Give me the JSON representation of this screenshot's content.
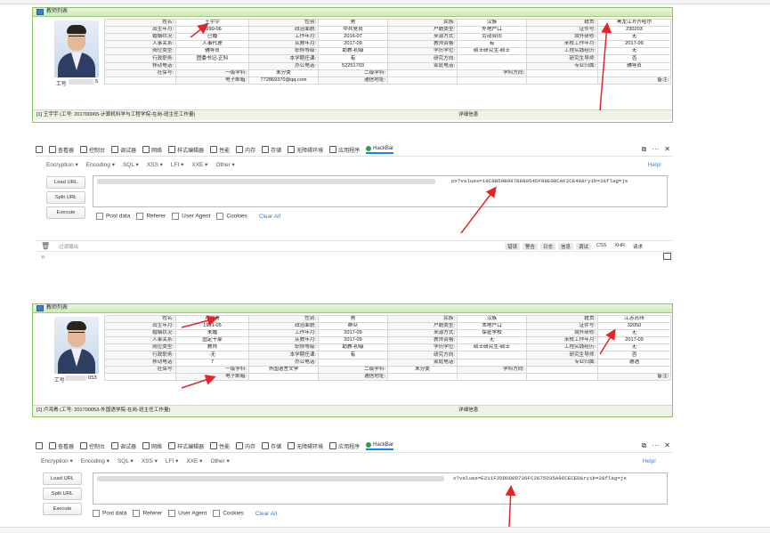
{
  "colors": {
    "accent_green": "#8cc46c",
    "annotation_red": "#e0262b",
    "hackbar_blue": "#3a7fc8"
  },
  "cards": [
    {
      "header_title": "教师列表",
      "staff_no_label": "工号",
      "staff_no_value": "5",
      "rows": [
        [
          "姓名:",
          "王宇宇",
          "性别:",
          "男",
          "民族:",
          "汉族",
          "籍贯:",
          "黑龙江齐齐哈尔"
        ],
        [
          "出生年月:",
          "1990-06",
          "政治面貌:",
          "中共党员",
          "户籍类型:",
          "外地户口",
          "证件号:",
          "230203"
        ],
        [
          "婚姻状况:",
          "已婚",
          "工作年月:",
          "2016-07",
          "来源方式:",
          "劳动合同",
          "境外研修:",
          "无"
        ],
        [
          "人事关系:",
          "人事代理",
          "从教年月:",
          "2017-09",
          "教师资格:",
          "有",
          "来校工作年月:",
          "2017-09"
        ],
        [
          "岗位类型:",
          "辅导员",
          "职称等级:",
          "助教-初级",
          "学历学位:",
          "硕士研究生-硕士",
          "工程实践经历:",
          "无"
        ],
        [
          "行政职务:",
          "团委书记-正科",
          "本学期任课:",
          "有",
          "研究方向:",
          "",
          "研究生导师:",
          "否"
        ],
        [
          "移动电话:",
          "",
          "办公电话:",
          "52251703",
          "家庭电话:",
          "",
          "专业归属:",
          "辅导员"
        ],
        [
          "社保号:",
          "一级学科:",
          "未分类",
          "二级学科:",
          "",
          "学科方向:",
          "",
          ""
        ],
        [
          "",
          "电子邮箱:",
          "772869370@qq.com",
          "通信地址:",
          "",
          "",
          "",
          "备注:"
        ]
      ],
      "footer_text": "[1] 王宇宇 (工号: 201700065-计算机科学与工程学院-在岗-班主任工作量)",
      "footer_link": "详细信息"
    },
    {
      "header_title": "教师列表",
      "staff_no_label": "工号",
      "staff_no_value": "053",
      "rows": [
        [
          "姓名:",
          "卢鸿青",
          "性别:",
          "男",
          "民族:",
          "汉族",
          "籍贯:",
          "江苏苏州"
        ],
        [
          "出生年月:",
          "1991-05",
          "政治面貌:",
          "群众",
          "户籍类型:",
          "本地户口",
          "证件号:",
          "32050"
        ],
        [
          "婚姻状况:",
          "未婚",
          "工作年月:",
          "2017-09",
          "来源方式:",
          "保密学校",
          "境外研修:",
          "无"
        ],
        [
          "人事关系:",
          "固定干部",
          "从教年月:",
          "2017-09",
          "教师资格:",
          "无",
          "来校工作年月:",
          "2017-09"
        ],
        [
          "岗位类型:",
          "教师",
          "职称等级:",
          "助教-初级",
          "学历学位:",
          "硕士研究生-硕士",
          "工程实践经历:",
          "无"
        ],
        [
          "行政职务:",
          "-无",
          "本学期任课:",
          "有",
          "研究方向:",
          "",
          "研究生导师:",
          "否"
        ],
        [
          "移动电话:",
          "7",
          "办公电话:",
          "",
          "家庭电话:",
          "",
          "专业归属:",
          "德语"
        ],
        [
          "社保号:",
          "一级学科:",
          "外国语言文学",
          "二级学科:",
          "未分类",
          "学科方向:",
          "",
          ""
        ],
        [
          "",
          "电子邮箱:",
          "",
          "通信地址:",
          "",
          "",
          "",
          "备注:"
        ]
      ],
      "footer_text": "[1] 卢鸿青 (工号: 201700053-外国语学院-在岗-班主任工作量)",
      "footer_link": "详细信息"
    }
  ],
  "devtools": {
    "tabs": [
      "查看器",
      "控制台",
      "调试器",
      "网络",
      "样式编辑器",
      "性能",
      "内存",
      "存储",
      "无障碍环境",
      "应用程序",
      "HackBar"
    ],
    "active_tab": "HackBar",
    "right_controls": [
      "⧉",
      "···",
      "✕"
    ]
  },
  "hackbar": {
    "menus": [
      "Encryption ▾",
      "Encoding ▾",
      "SQL ▾",
      "XSS ▾",
      "LFI ▾",
      "XXE ▾",
      "Other ▾"
    ],
    "help": "Help!",
    "buttons": [
      "Load URL",
      "Split URL",
      "Execute"
    ],
    "checkboxes": [
      "Post data",
      "Referer",
      "User Agent",
      "Cookies"
    ],
    "clear_all": "Clear All",
    "url_tail_1": "px?values=19C8B50B9978880545F08E08CAF2CE40&ryib=2&flag=js",
    "url_tail_2": "x?values=E211F2DDDD0D736FC2675D35A96CECED&ryib=2&flag=js"
  },
  "console": {
    "filter_placeholder": "过滤输出",
    "levels": [
      "错误",
      "警告",
      "日志",
      "信息",
      "调试"
    ],
    "extras": [
      "CSS",
      "XHR",
      "请求"
    ],
    "prompt": "»"
  }
}
